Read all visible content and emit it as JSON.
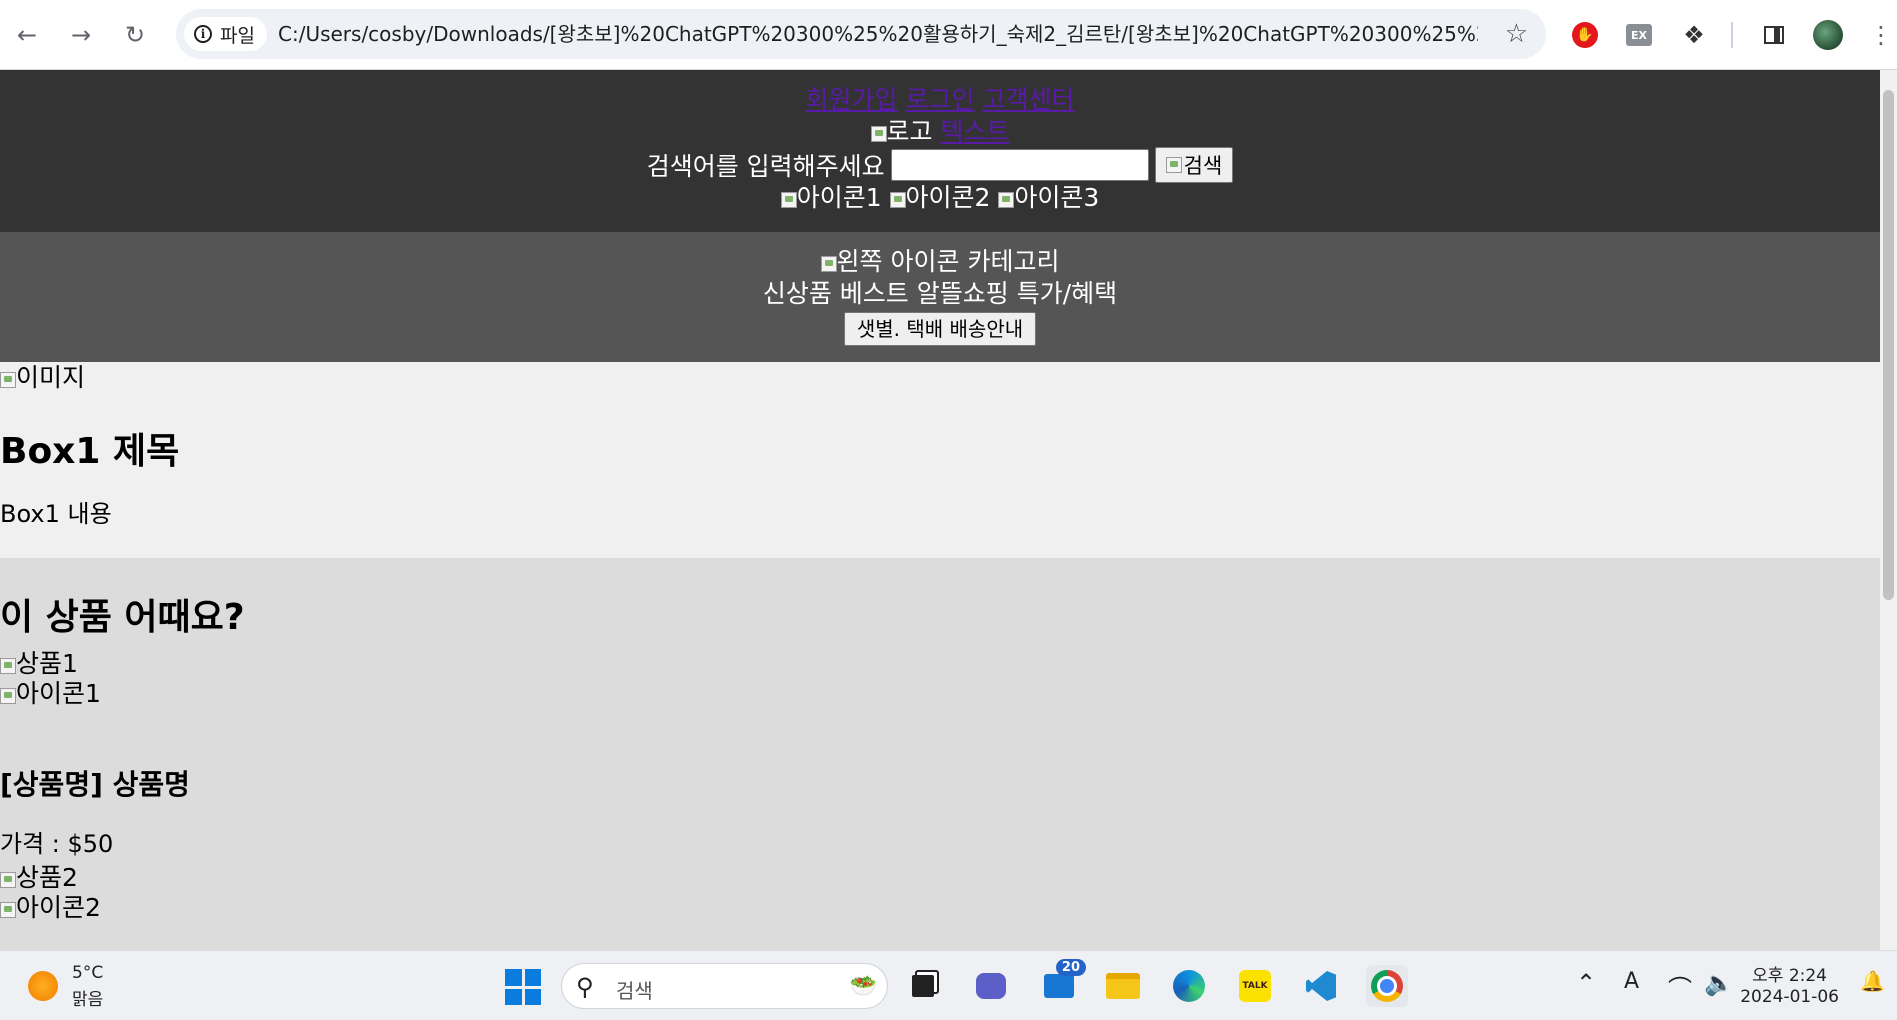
{
  "browser": {
    "site_label": "파일",
    "url": "C:/Users/cosby/Downloads/[왕초보]%20ChatGPT%20300%25%20활용하기_숙제2_김르탄/[왕초보]%20ChatGPT%20300%25%2..."
  },
  "header": {
    "links": [
      "회원가입",
      "로그인",
      "고객센터"
    ],
    "logo_alt": "로고",
    "text_link": "텍스트",
    "search_label": "검색어를 입력해주세요",
    "search_value": "",
    "search_button_alt": "검색",
    "icons": [
      "아이콘1",
      "아이콘2",
      "아이콘3"
    ]
  },
  "category_nav": {
    "left_icon_alt": "왼쪽 아이콘",
    "category_label": "카테고리",
    "menu": "신상품 베스트 알뜰쇼핑 특가/혜택",
    "shipping_button": "샛별. 택배 배송안내"
  },
  "box1": {
    "image_alt": "이미지",
    "title": "Box1 제목",
    "content": "Box1 내용"
  },
  "products": {
    "heading": "이 상품 어때요?",
    "items": [
      {
        "image_alt": "상품1",
        "icon_alt": "아이콘1",
        "name": "[상품명] 상품명",
        "price": "가격 : $50"
      },
      {
        "image_alt": "상품2",
        "icon_alt": "아이콘2"
      }
    ]
  },
  "taskbar": {
    "temperature": "5°C",
    "weather": "맑음",
    "search_label": "검색",
    "notification_count": "20",
    "time": "오후 2:24",
    "date": "2024-01-06",
    "ime_label": "A"
  }
}
